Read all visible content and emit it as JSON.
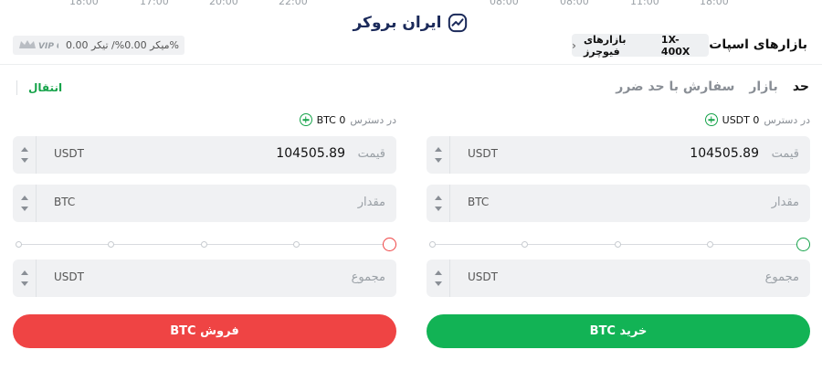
{
  "chart_ticks": [
    "18:00",
    "17:00",
    "20:00",
    "22:00",
    "08:00",
    "08:00",
    "11:00",
    "18:00"
  ],
  "logo": {
    "text": "ایران بروکر",
    "icon": "chart-trend-icon"
  },
  "header": {
    "title": "بازارهای اسپات",
    "futures_chip": {
      "pair": "1X-400X",
      "label": "بازارهای فیوچرز",
      "icon": "chevron-left-icon"
    },
    "fees": {
      "text": "میکر 0.00%/ تیکر 0.00%",
      "icon": "vip-crown-icon"
    }
  },
  "tabs": [
    "حد",
    "بازار",
    "سفارش با حد ضرر"
  ],
  "active_tab": "حد",
  "transfer_label": "انتقال",
  "buy": {
    "available_label": "در دسترس",
    "available_value": "USDT 0",
    "price": {
      "value": "104505.89",
      "label": "قیمت",
      "unit": "USDT"
    },
    "amount": {
      "label": "مقدار",
      "unit": "BTC"
    },
    "total": {
      "label": "مجموع",
      "unit": "USDT"
    },
    "slider_value": 0,
    "button": "خرید BTC",
    "accent": "#12b355"
  },
  "sell": {
    "available_label": "در دسترس",
    "available_value": "BTC 0",
    "price": {
      "value": "104505.89",
      "label": "قیمت",
      "unit": "USDT"
    },
    "amount": {
      "label": "مقدار",
      "unit": "BTC"
    },
    "total": {
      "label": "مجموع",
      "unit": "USDT"
    },
    "slider_value": 0,
    "button": "فروش BTC",
    "accent": "#ef4444"
  }
}
